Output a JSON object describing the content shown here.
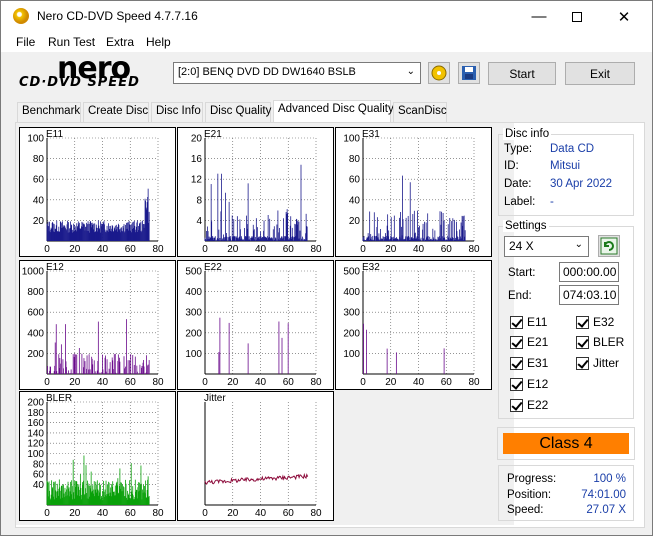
{
  "window": {
    "title": "Nero CD-DVD Speed 4.7.7.16"
  },
  "menu": [
    "File",
    "Run Test",
    "Extra",
    "Help"
  ],
  "toolbar": {
    "drive": "[2:0]   BENQ DVD DD DW1640 BSLB",
    "start_label": "Start",
    "exit_label": "Exit"
  },
  "logo": {
    "brand": "nero",
    "product": "CD·DVD SPEED"
  },
  "tabs": [
    "Benchmark",
    "Create Disc",
    "Disc Info",
    "Disc Quality",
    "Advanced Disc Quality",
    "ScanDisc"
  ],
  "active_tab": "Advanced Disc Quality",
  "disc_info": {
    "title": "Disc info",
    "type_label": "Type:",
    "type": "Data CD",
    "id_label": "ID:",
    "id": "Mitsui",
    "date_label": "Date:",
    "date": "30 Apr 2022",
    "label_label": "Label:",
    "label": "-"
  },
  "settings": {
    "title": "Settings",
    "speed": "24 X",
    "start_label": "Start:",
    "start": "000:00.00",
    "end_label": "End:",
    "end": "074:03.10",
    "checks": [
      "E11",
      "E32",
      "E21",
      "BLER",
      "E31",
      "Jitter",
      "E12",
      "E22"
    ]
  },
  "class_badge": "Class 4",
  "progress": {
    "progress_label": "Progress:",
    "progress": "100 %",
    "position_label": "Position:",
    "position": "74:01.00",
    "speed_label": "Speed:",
    "speed": "27.07 X"
  },
  "chart_data": [
    {
      "type": "bar",
      "title": "E11",
      "color": "#1a1a8c",
      "xlim": [
        0,
        80
      ],
      "ylim": [
        0,
        100
      ],
      "yticks": [
        20,
        40,
        60,
        80,
        100
      ],
      "xticks": [
        0,
        20,
        40,
        60,
        80
      ]
    },
    {
      "type": "bar",
      "title": "E21",
      "color": "#1a1a8c",
      "xlim": [
        0,
        80
      ],
      "ylim": [
        0,
        20
      ],
      "yticks": [
        4,
        8,
        12,
        16,
        20
      ],
      "xticks": [
        0,
        20,
        40,
        60,
        80
      ]
    },
    {
      "type": "bar",
      "title": "E31",
      "color": "#1a1a8c",
      "xlim": [
        0,
        80
      ],
      "ylim": [
        0,
        100
      ],
      "yticks": [
        20,
        40,
        60,
        80,
        100
      ],
      "xticks": [
        0,
        20,
        40,
        60,
        80
      ]
    },
    {
      "type": "bar",
      "title": "E12",
      "color": "#6a0a8c",
      "xlim": [
        0,
        80
      ],
      "ylim": [
        0,
        1000
      ],
      "yticks": [
        200,
        400,
        600,
        800,
        1000
      ],
      "xticks": [
        0,
        20,
        40,
        60,
        80
      ]
    },
    {
      "type": "bar",
      "title": "E22",
      "color": "#6a0a8c",
      "xlim": [
        0,
        80
      ],
      "ylim": [
        0,
        500
      ],
      "yticks": [
        100,
        200,
        300,
        400,
        500
      ],
      "xticks": [
        0,
        20,
        40,
        60,
        80
      ]
    },
    {
      "type": "bar",
      "title": "E32",
      "color": "#6a0a8c",
      "xlim": [
        0,
        80
      ],
      "ylim": [
        0,
        500
      ],
      "yticks": [
        100,
        200,
        300,
        400,
        500
      ],
      "xticks": [
        0,
        20,
        40,
        60,
        80
      ]
    },
    {
      "type": "bar",
      "title": "BLER",
      "color": "#0aa00a",
      "xlim": [
        0,
        80
      ],
      "ylim": [
        0,
        200
      ],
      "yticks": [
        40,
        60,
        80,
        100,
        120,
        140,
        160,
        180,
        200
      ],
      "xticks": [
        0,
        20,
        40,
        60,
        80
      ]
    },
    {
      "type": "line",
      "title": "Jitter",
      "color": "#8c0a3a",
      "xlim": [
        0,
        80
      ],
      "ylim": [
        0,
        50
      ],
      "yticks": [],
      "xticks": [
        0,
        20,
        40,
        60,
        80
      ]
    }
  ]
}
